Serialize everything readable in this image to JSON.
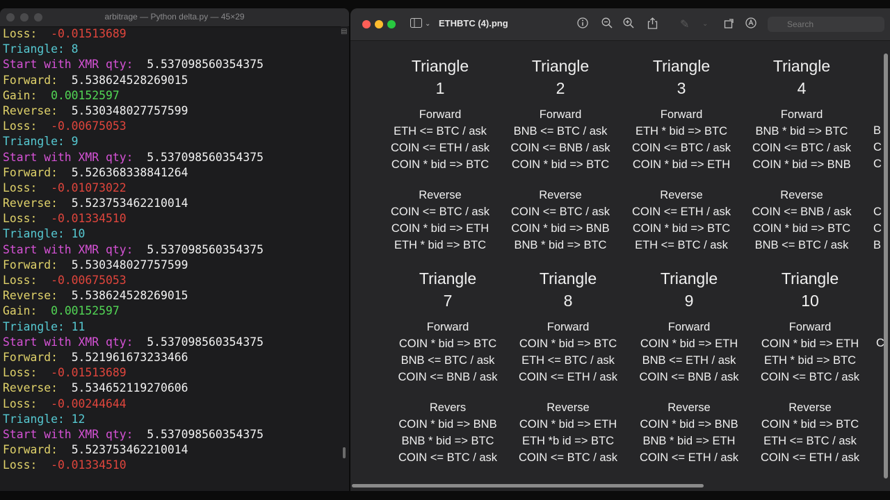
{
  "terminal": {
    "title": "arbitrage — Python delta.py — 45×29",
    "lines": [
      {
        "k": "Loss:  ",
        "kc": "c-loss",
        "v": "-0.01513689",
        "vc": "c-neg"
      },
      {
        "k": "Triangle: 8",
        "kc": "c-tri",
        "v": "",
        "vc": "c-num"
      },
      {
        "k": "Start with XMR qty:  ",
        "kc": "c-start",
        "v": "5.537098560354375",
        "vc": "c-num"
      },
      {
        "k": "Forward:  ",
        "kc": "c-fwd",
        "v": "5.538624528269015",
        "vc": "c-num"
      },
      {
        "k": "Gain:  ",
        "kc": "c-gain",
        "v": "0.00152597",
        "vc": "c-pos"
      },
      {
        "k": "Reverse:  ",
        "kc": "c-fwd",
        "v": "5.530348027757599",
        "vc": "c-num"
      },
      {
        "k": "Loss:  ",
        "kc": "c-loss",
        "v": "-0.00675053",
        "vc": "c-neg"
      },
      {
        "k": "Triangle: 9",
        "kc": "c-tri",
        "v": "",
        "vc": "c-num"
      },
      {
        "k": "Start with XMR qty:  ",
        "kc": "c-start",
        "v": "5.537098560354375",
        "vc": "c-num"
      },
      {
        "k": "Forward:  ",
        "kc": "c-fwd",
        "v": "5.526368338841264",
        "vc": "c-num"
      },
      {
        "k": "Loss:  ",
        "kc": "c-loss",
        "v": "-0.01073022",
        "vc": "c-neg"
      },
      {
        "k": "Reverse:  ",
        "kc": "c-fwd",
        "v": "5.523753462210014",
        "vc": "c-num"
      },
      {
        "k": "Loss:  ",
        "kc": "c-loss",
        "v": "-0.01334510",
        "vc": "c-neg"
      },
      {
        "k": "Triangle: 10",
        "kc": "c-tri",
        "v": "",
        "vc": "c-num"
      },
      {
        "k": "Start with XMR qty:  ",
        "kc": "c-start",
        "v": "5.537098560354375",
        "vc": "c-num"
      },
      {
        "k": "Forward:  ",
        "kc": "c-fwd",
        "v": "5.530348027757599",
        "vc": "c-num"
      },
      {
        "k": "Loss:  ",
        "kc": "c-loss",
        "v": "-0.00675053",
        "vc": "c-neg"
      },
      {
        "k": "Reverse:  ",
        "kc": "c-fwd",
        "v": "5.538624528269015",
        "vc": "c-num"
      },
      {
        "k": "Gain:  ",
        "kc": "c-gain",
        "v": "0.00152597",
        "vc": "c-pos"
      },
      {
        "k": "Triangle: 11",
        "kc": "c-tri",
        "v": "",
        "vc": "c-num"
      },
      {
        "k": "Start with XMR qty:  ",
        "kc": "c-start",
        "v": "5.537098560354375",
        "vc": "c-num"
      },
      {
        "k": "Forward:  ",
        "kc": "c-fwd",
        "v": "5.521961673233466",
        "vc": "c-num"
      },
      {
        "k": "Loss:  ",
        "kc": "c-loss",
        "v": "-0.01513689",
        "vc": "c-neg"
      },
      {
        "k": "Reverse:  ",
        "kc": "c-fwd",
        "v": "5.534652119270606",
        "vc": "c-num"
      },
      {
        "k": "Loss:  ",
        "kc": "c-loss",
        "v": "-0.00244644",
        "vc": "c-neg"
      },
      {
        "k": "Triangle: 12",
        "kc": "c-tri",
        "v": "",
        "vc": "c-num"
      },
      {
        "k": "Start with XMR qty:  ",
        "kc": "c-start",
        "v": "5.537098560354375",
        "vc": "c-num"
      },
      {
        "k": "Forward:  ",
        "kc": "c-fwd",
        "v": "5.523753462210014",
        "vc": "c-num"
      },
      {
        "k": "Loss:  ",
        "kc": "c-loss",
        "v": "-0.01334510",
        "vc": "c-neg"
      }
    ]
  },
  "preview": {
    "doc_title": "ETHBTC (4).png",
    "search_placeholder": "Search",
    "icons": [
      "sidebar-icon",
      "info-icon",
      "zoom-out-icon",
      "zoom-in-icon",
      "share-icon",
      "markup-icon",
      "rotate-icon",
      "annotate-icon"
    ],
    "triangles": [
      {
        "h1": "Triangle",
        "h2": "1",
        "fwd_label": "Forward",
        "fwd": [
          "ETH <= BTC / ask",
          "COIN <= ETH / ask",
          "COIN * bid => BTC"
        ],
        "rev_label": "Reverse",
        "rev": [
          "COIN <= BTC / ask",
          "COIN * bid => ETH",
          "ETH * bid => BTC"
        ]
      },
      {
        "h1": "Triangle",
        "h2": "2",
        "fwd_label": "Forward",
        "fwd": [
          "BNB <= BTC / ask",
          "COIN <= BNB / ask",
          "COIN * bid => BTC"
        ],
        "rev_label": "Reverse",
        "rev": [
          "COIN <= BTC / ask",
          "COIN * bid => BNB",
          "BNB * bid => BTC"
        ]
      },
      {
        "h1": "Triangle",
        "h2": "3",
        "fwd_label": "Forward",
        "fwd": [
          "ETH * bid => BTC",
          "COIN <= BTC / ask",
          "COIN * bid => ETH"
        ],
        "rev_label": "Reverse",
        "rev": [
          "COIN <= ETH / ask",
          "COIN * bid => BTC",
          "ETH <= BTC / ask"
        ]
      },
      {
        "h1": "Triangle",
        "h2": "4",
        "fwd_label": "Forward",
        "fwd": [
          "BNB * bid => BTC",
          "COIN <= BTC / ask",
          "COIN * bid => BNB"
        ],
        "rev_label": "Reverse",
        "rev": [
          "COIN <= BNB / ask",
          "COIN * bid => BTC",
          "BNB <= BTC / ask"
        ]
      },
      {
        "h1": "Triangle",
        "h2": "7",
        "fwd_label": "Forward",
        "fwd": [
          "COIN * bid => BTC",
          "BNB <= BTC / ask",
          "COIN <= BNB / ask"
        ],
        "rev_label": "Revers",
        "rev": [
          "COIN * bid => BNB",
          "BNB * bid => BTC",
          "COIN <= BTC / ask"
        ]
      },
      {
        "h1": "Triangle",
        "h2": "8",
        "fwd_label": "Forward",
        "fwd": [
          "COIN * bid => BTC",
          "ETH <= BTC / ask",
          "COIN <= ETH / ask"
        ],
        "rev_label": "Reverse",
        "rev": [
          "COIN * bid => ETH",
          "ETH *b id => BTC",
          "COIN <= BTC / ask"
        ]
      },
      {
        "h1": "Triangle",
        "h2": "9",
        "fwd_label": "Forward",
        "fwd": [
          "COIN * bid => ETH",
          "BNB <= ETH / ask",
          "COIN <= BNB / ask"
        ],
        "rev_label": "Reverse",
        "rev": [
          "COIN * bid => BNB",
          "BNB * bid => ETH",
          "COIN <= ETH / ask"
        ]
      },
      {
        "h1": "Triangle",
        "h2": "10",
        "fwd_label": "Forward",
        "fwd": [
          "COIN * bid => ETH",
          "ETH * bid => BTC",
          "COIN <= BTC / ask"
        ],
        "rev_label": "Reverse",
        "rev": [
          "COIN * bid => BTC",
          "ETH <= BTC / ask",
          "COIN <= ETH / ask"
        ]
      }
    ],
    "partial_top": [
      "B",
      "C",
      "C",
      "C",
      "C",
      "B"
    ],
    "partial_bottom": [
      "C"
    ]
  }
}
